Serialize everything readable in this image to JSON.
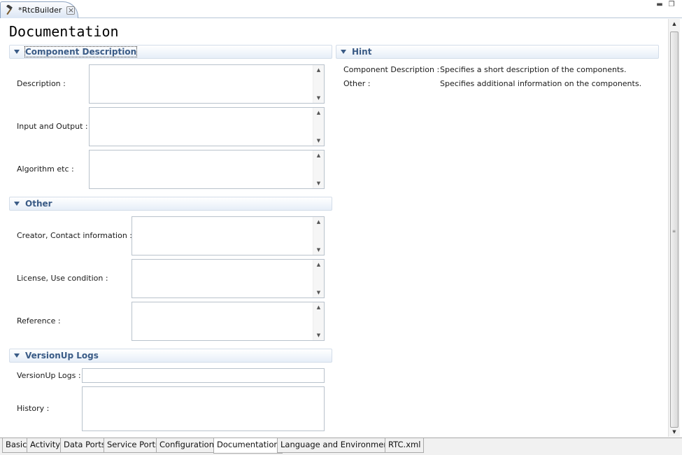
{
  "editor": {
    "tab_title": "*RtcBuilder",
    "tab_icon": "hammer-icon",
    "form_title": "Documentation"
  },
  "component_description": {
    "title": "Component Description",
    "fields": [
      {
        "label": "Description :",
        "value": ""
      },
      {
        "label": "Input and Output :",
        "value": ""
      },
      {
        "label": "Algorithm etc :",
        "value": ""
      }
    ]
  },
  "other": {
    "title": "Other",
    "fields": [
      {
        "label": "Creator, Contact information :",
        "value": ""
      },
      {
        "label": "License, Use condition :",
        "value": ""
      },
      {
        "label": "Reference :",
        "value": ""
      }
    ]
  },
  "versionup": {
    "title": "VersionUp Logs",
    "log_label": "VersionUp Logs :",
    "log_value": "",
    "history_label": "History :",
    "history_value": ""
  },
  "hint": {
    "title": "Hint",
    "rows": [
      {
        "term": "Component Description :",
        "text": "Specifies a short description of the components."
      },
      {
        "term": "Other :",
        "text": "Specifies additional information on the components."
      }
    ]
  },
  "page_tabs": [
    "Basic",
    "Activity",
    "Data Ports",
    "Service Ports",
    "Configuration",
    "Documentation",
    "Language and Environment",
    "RTC.xml"
  ],
  "active_page_tab": "Documentation",
  "colors": {
    "section_title": "#3a5b86",
    "tab_border": "#8ea4c2"
  }
}
